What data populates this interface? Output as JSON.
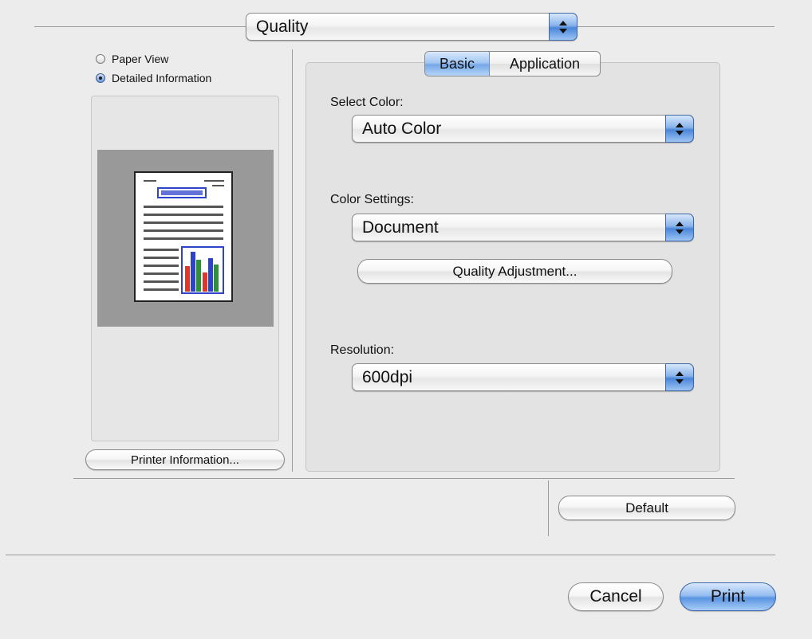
{
  "pane_menu": {
    "label": "Quality"
  },
  "preview": {
    "view_options": [
      {
        "label": "Paper View",
        "selected": false
      },
      {
        "label": "Detailed Information",
        "selected": true
      }
    ],
    "printer_info_button": "Printer Information..."
  },
  "tabs": [
    {
      "label": "Basic",
      "selected": true
    },
    {
      "label": "Application",
      "selected": false
    }
  ],
  "settings": {
    "select_color_label": "Select Color:",
    "select_color_value": "Auto Color",
    "color_settings_label": "Color Settings:",
    "color_settings_value": "Document",
    "quality_adjustment_button": "Quality Adjustment...",
    "resolution_label": "Resolution:",
    "resolution_value": "600dpi"
  },
  "buttons": {
    "default": "Default",
    "cancel": "Cancel",
    "print": "Print"
  },
  "colors": {
    "accent_blue": "#5a94e2",
    "window_bg": "#ececec",
    "preview_gray": "#999999",
    "bar_blue": "#2d43c9",
    "bar_red": "#d83a2c",
    "bar_green": "#2f8f3a"
  },
  "icons": {
    "popup_arrows": "up-down-arrows-icon",
    "document_preview": "document-thumbnail-icon"
  }
}
